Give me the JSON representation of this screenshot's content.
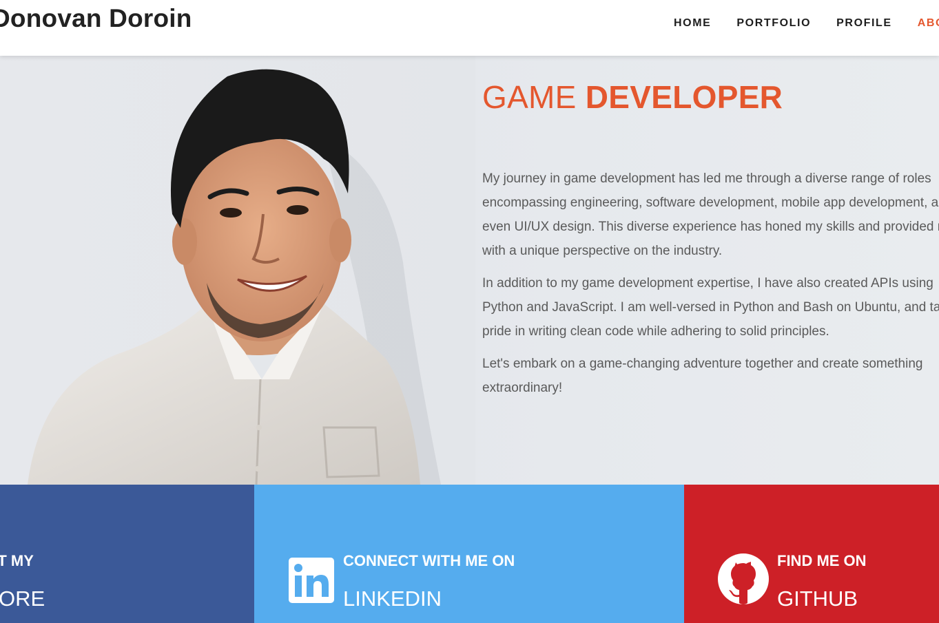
{
  "header": {
    "brand": "Donovan Doroin",
    "nav": [
      "HOME",
      "PORTFOLIO",
      "PROFILE",
      "ABOUT"
    ]
  },
  "hero": {
    "title_light": "GAME",
    "title_bold": "DEVELOPER",
    "paragraphs": [
      "My journey in game development has led me through a diverse range of roles encompassing engineering, software development, mobile app development, and even UI/UX design. This diverse experience has honed my skills and provided me with a unique perspective on the industry.",
      "In addition to my game development expertise, I have also created APIs using Python and JavaScript. I am well-versed in Python and Bash on Ubuntu, and take pride in writing clean code while adhering to solid principles.",
      "Let's embark on a game-changing adventure together and create something extraordinary!"
    ]
  },
  "social": {
    "facebook": {
      "small": "CHECK OUT MY",
      "big": "STORE",
      "color": "#3b5998"
    },
    "linkedin": {
      "small": "CONNECT WITH ME ON",
      "big": "LINKEDIN",
      "color": "#55acee",
      "icon": "linkedin-icon"
    },
    "github": {
      "small": "FIND ME ON",
      "big": "GITHUB",
      "color": "#cd2027",
      "icon": "github-icon"
    }
  },
  "colors": {
    "accent": "#e4572e",
    "text": "#5a5a5a",
    "brand_text": "#222222"
  }
}
